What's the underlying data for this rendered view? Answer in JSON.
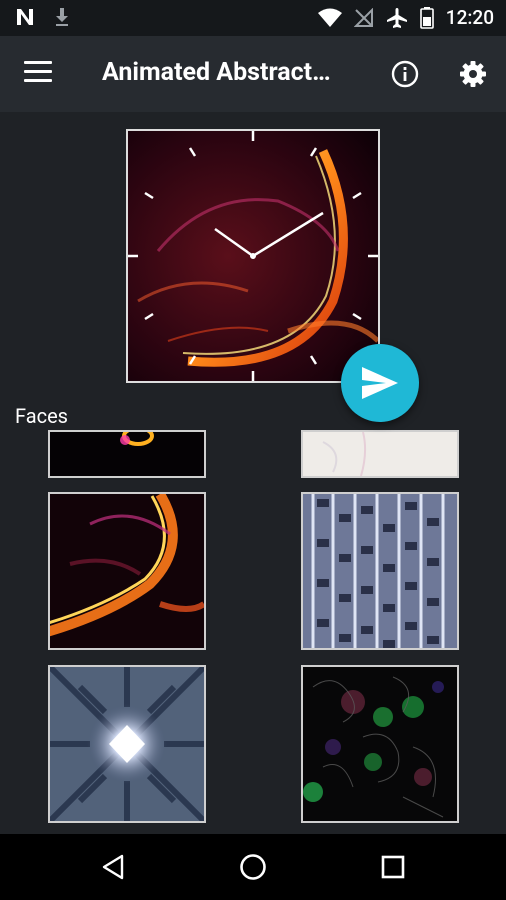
{
  "status_bar": {
    "time": "12:20",
    "icons": [
      "notification-n-icon",
      "download-icon",
      "wifi-icon",
      "no-signal-icon",
      "airplane-icon",
      "battery-icon"
    ]
  },
  "app_bar": {
    "title": "Animated Abstract…",
    "icons": [
      "menu-icon",
      "info-icon",
      "settings-gear-icon"
    ]
  },
  "preview": {
    "icon": "send-icon",
    "accent_color": "#1fb8d6"
  },
  "faces": {
    "label": "Faces",
    "items": [
      "fire-bubble",
      "white-texture",
      "fire-bubble-large",
      "metal-chains",
      "kaleidoscope-diamond",
      "green-bokeh-particles"
    ]
  },
  "nav_bar": {
    "icons": [
      "back-icon",
      "home-icon",
      "recents-icon"
    ]
  }
}
